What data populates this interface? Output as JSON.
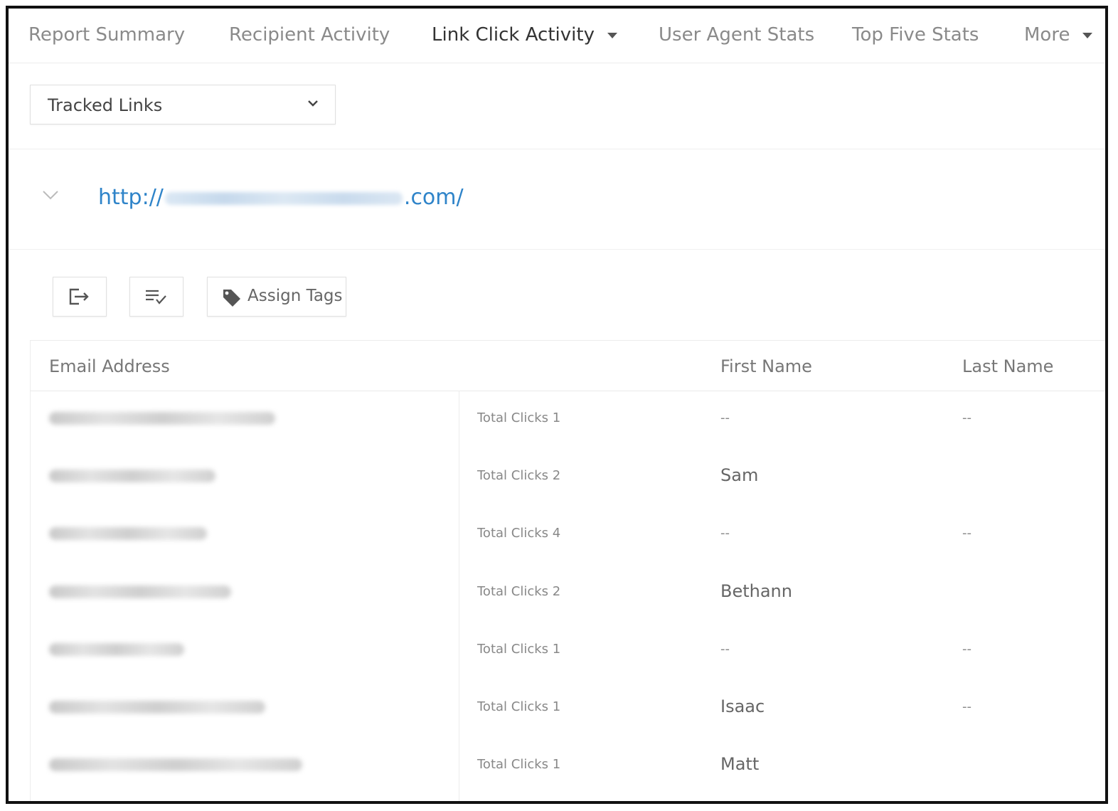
{
  "nav": {
    "tabs": [
      {
        "label": "Report Summary"
      },
      {
        "label": "Recipient Activity"
      },
      {
        "label": "Link Click Activity"
      },
      {
        "label": "User Agent Stats"
      },
      {
        "label": "Top Five Stats"
      },
      {
        "label": "More"
      }
    ],
    "active_index": 2
  },
  "filter": {
    "selected": "Tracked Links"
  },
  "link": {
    "prefix": "http://",
    "suffix": ".com/"
  },
  "toolbar": {
    "assign_tags_label": "Assign Tags"
  },
  "table": {
    "columns": {
      "email": "Email Address",
      "first_name": "First Name",
      "last_name": "Last Name"
    },
    "rows": [
      {
        "clicks": "Total Clicks 1",
        "first_name": "--",
        "last_name": "--"
      },
      {
        "clicks": "Total Clicks 2",
        "first_name": "Sam",
        "last_name": ""
      },
      {
        "clicks": "Total Clicks 4",
        "first_name": "--",
        "last_name": "--"
      },
      {
        "clicks": "Total Clicks 2",
        "first_name": "Bethann",
        "last_name": ""
      },
      {
        "clicks": "Total Clicks 1",
        "first_name": "--",
        "last_name": "--"
      },
      {
        "clicks": "Total Clicks 1",
        "first_name": "Isaac",
        "last_name": "--"
      },
      {
        "clicks": "Total Clicks 1",
        "first_name": "Matt",
        "last_name": ""
      }
    ]
  },
  "colors": {
    "link": "#2f84c9",
    "text": "#555555",
    "muted": "#888888",
    "border": "#e1e1e1"
  }
}
